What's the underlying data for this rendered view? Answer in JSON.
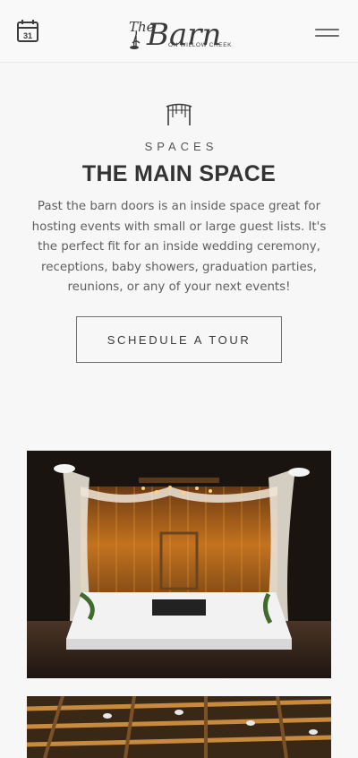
{
  "header": {
    "calendar_day": "31",
    "logo_script": "The Barn",
    "logo_subtitle": "ON WILLOW CREEK"
  },
  "section": {
    "eyebrow": "SPACES",
    "title": "THE MAIN SPACE",
    "description": "Past the barn doors is an inside space great for hosting events with small or large guest lists. It's the perfect fit for an inside wedding ceremony, receptions, baby showers, graduation parties, reunions, or any of your next events!",
    "cta_label": "SCHEDULE A TOUR"
  },
  "colors": {
    "background": "#f7f7f7",
    "text": "#333333",
    "button_border": "#707070"
  },
  "icons": [
    "calendar-icon",
    "menu-icon",
    "pergola-icon"
  ]
}
